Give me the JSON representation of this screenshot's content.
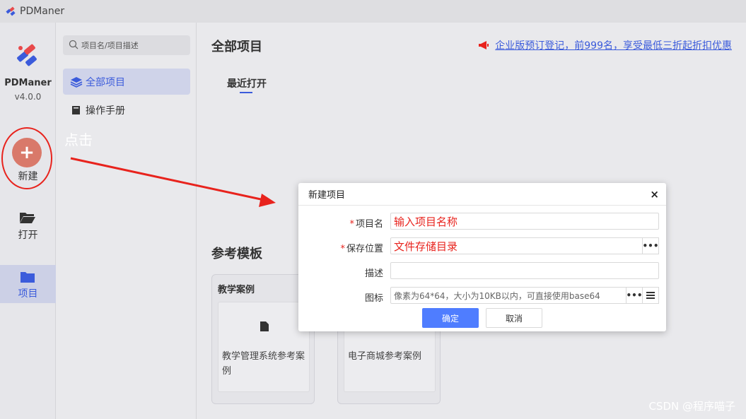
{
  "app": {
    "title": "PDManer"
  },
  "rail": {
    "brand_name": "PDManer",
    "version": "v4.0.0",
    "new_label": "新建",
    "open_label": "打开",
    "project_label": "项目"
  },
  "sidebar": {
    "search_placeholder": "项目名/项目描述",
    "nav_all": "全部项目",
    "nav_manual": "操作手册",
    "annotation": "点击"
  },
  "main": {
    "title": "全部项目",
    "promo": "企业版预订登记，前999名，享受最低三折起折扣优惠",
    "recent_tab": "最近打开",
    "templates_title": "参考模板",
    "cards": [
      {
        "tag": "教学案例",
        "text": "教学管理系统参考案例"
      },
      {
        "tag": "",
        "text": "电子商城参考案例"
      }
    ]
  },
  "dialog": {
    "title": "新建项目",
    "close": "×",
    "fields": {
      "name_label": "项目名",
      "name_value": "输入项目名称",
      "location_label": "保存位置",
      "location_value": "文件存储目录",
      "desc_label": "描述",
      "desc_value": "",
      "icon_label": "图标",
      "icon_placeholder": "像素为64*64，大小为10KB以内，可直接使用base64"
    },
    "required_mark": "*",
    "dots": "•••",
    "ok": "确定",
    "cancel": "取消"
  },
  "watermark": "CSDN @程序喵子",
  "colors": {
    "accent": "#3b5bdb",
    "primary_button": "#4f7dff",
    "annotation_red": "#e8231d"
  }
}
